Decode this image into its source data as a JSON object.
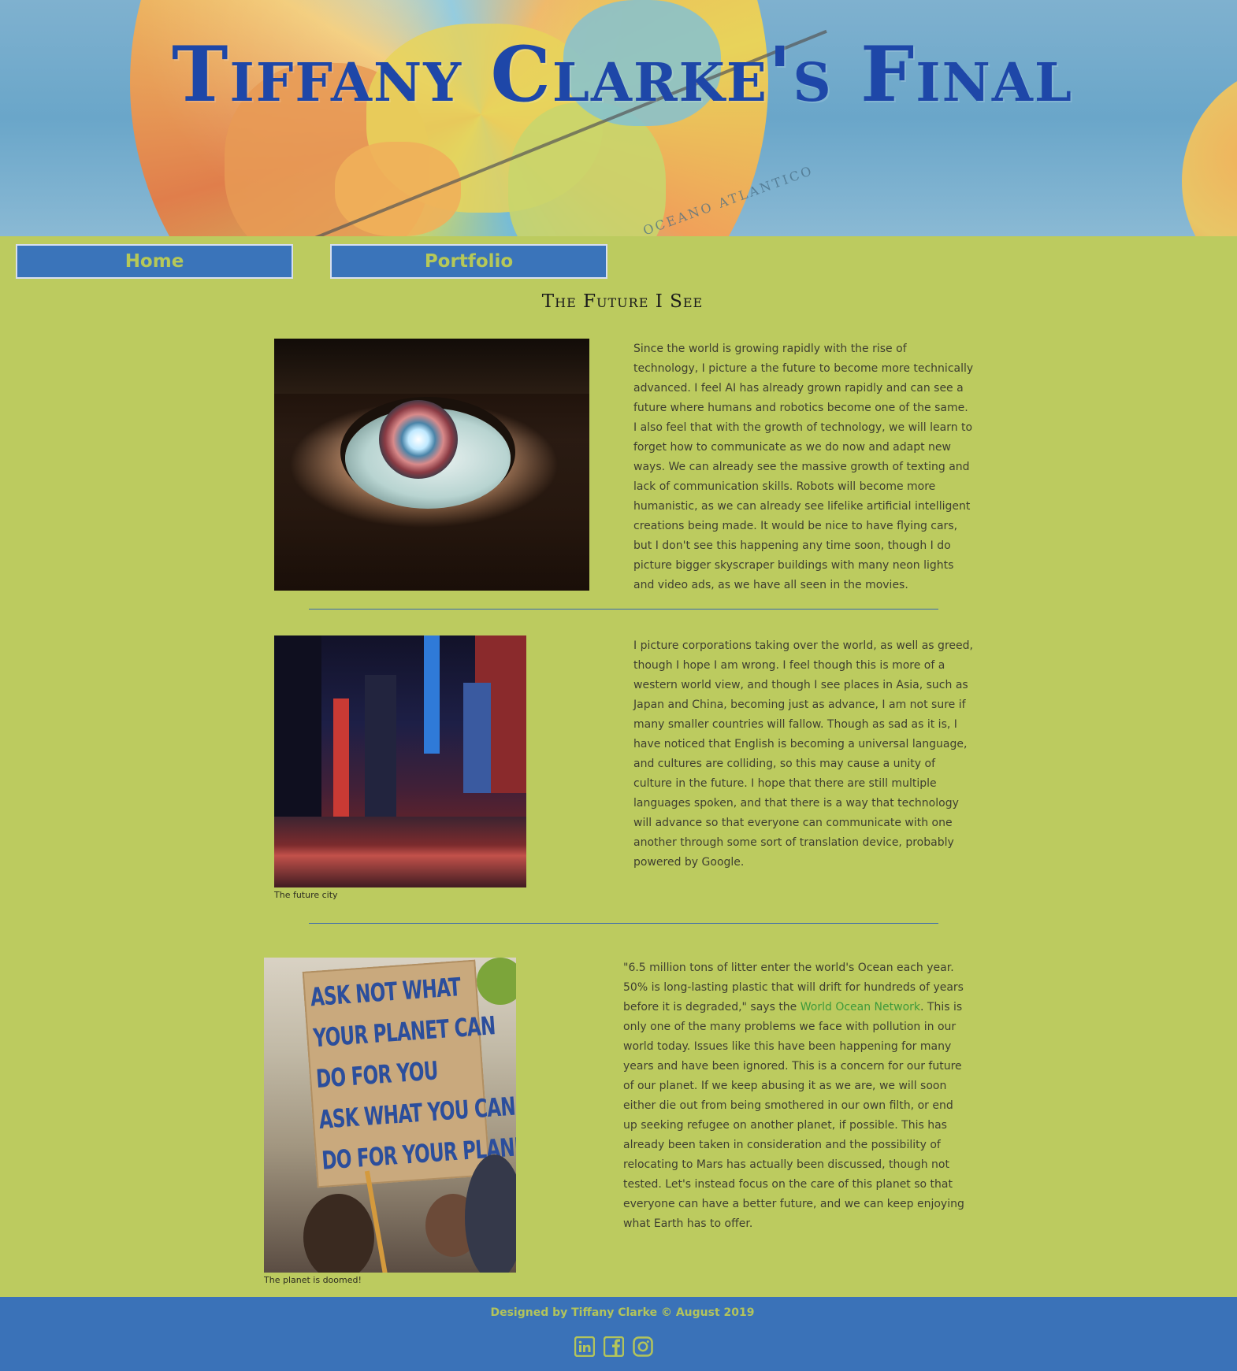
{
  "header": {
    "title": "Tiffany Clarke's Final",
    "globe_text": "OCEANO ATLANTICO"
  },
  "nav": {
    "home_label": "Home",
    "portfolio_label": "Portfolio"
  },
  "main": {
    "title": "The Future I See",
    "sections": [
      {
        "text": "Since the world is growing rapidly with the rise of technology, I picture a the future to become more technically advanced. I feel AI has already grown rapidly and can see a future where humans and robotics become one of the same. I also feel that with the growth of technology, we will learn to forget how to communicate as we do now and adapt new ways. We can already see the massive growth of texting and lack of communication skills. Robots will become more humanistic, as we can already see lifelike artificial intelligent creations being made. It would be nice to have flying cars, but I don't see this happening any time soon, though I do picture bigger skyscraper buildings with many neon lights and video ads, as we have all seen in the movies.",
        "caption": ""
      },
      {
        "text": "I picture corporations taking over the world, as well as greed, though I hope I am wrong. I feel though this is more of a western world view, and though I see places in Asia, such as Japan and China, becoming just as advance, I am not sure if many smaller countries will fallow. Though as sad as it is, I have noticed that English is becoming a universal language, and cultures are colliding, so this may cause a unity of culture in the future. I hope that there are still multiple languages spoken, and that there is a way that technology will advance so that everyone can communicate with one another through some sort of translation device, probably powered by Google.",
        "caption": "The future city"
      },
      {
        "text_before_link": "\"6.5 million tons of litter enter the world's Ocean each year. 50% is long-lasting plastic that will drift for hundreds of years before it is degraded,\" says the ",
        "link_text": "World Ocean Network",
        "text_after_link": ". This is only one of the many problems we face with pollution in our world today. Issues like this have been happening for many years and have been ignored. This is a concern for our future of our planet. If we keep abusing it as we are, we will soon either die out from being smothered in our own filth, or end up seeking refugee on another planet, if possible. This has already been taken in consideration and the possibility of relocating to Mars has actually been discussed, though not tested. Let's instead focus on the care of this planet so that everyone can have a better future, and we can keep enjoying what Earth has to offer.",
        "caption": "The planet is doomed!"
      }
    ],
    "sign_lines": [
      "ASK NOT WHAT",
      "YOUR PLANET CAN",
      "DO FOR YOU",
      "ASK WHAT YOU CAN",
      "DO FOR YOUR PLANET"
    ]
  },
  "footer": {
    "credit": "Designed by Tiffany Clarke © August 2019",
    "social_icons": [
      "linkedin-icon",
      "facebook-icon",
      "instagram-icon"
    ]
  },
  "colors": {
    "page_bg": "#bccb5f",
    "nav_bg": "#3a74ba",
    "title_blue": "#1e47a8",
    "link_green": "#3e9a3a",
    "footer_bg": "#3a72b8"
  }
}
